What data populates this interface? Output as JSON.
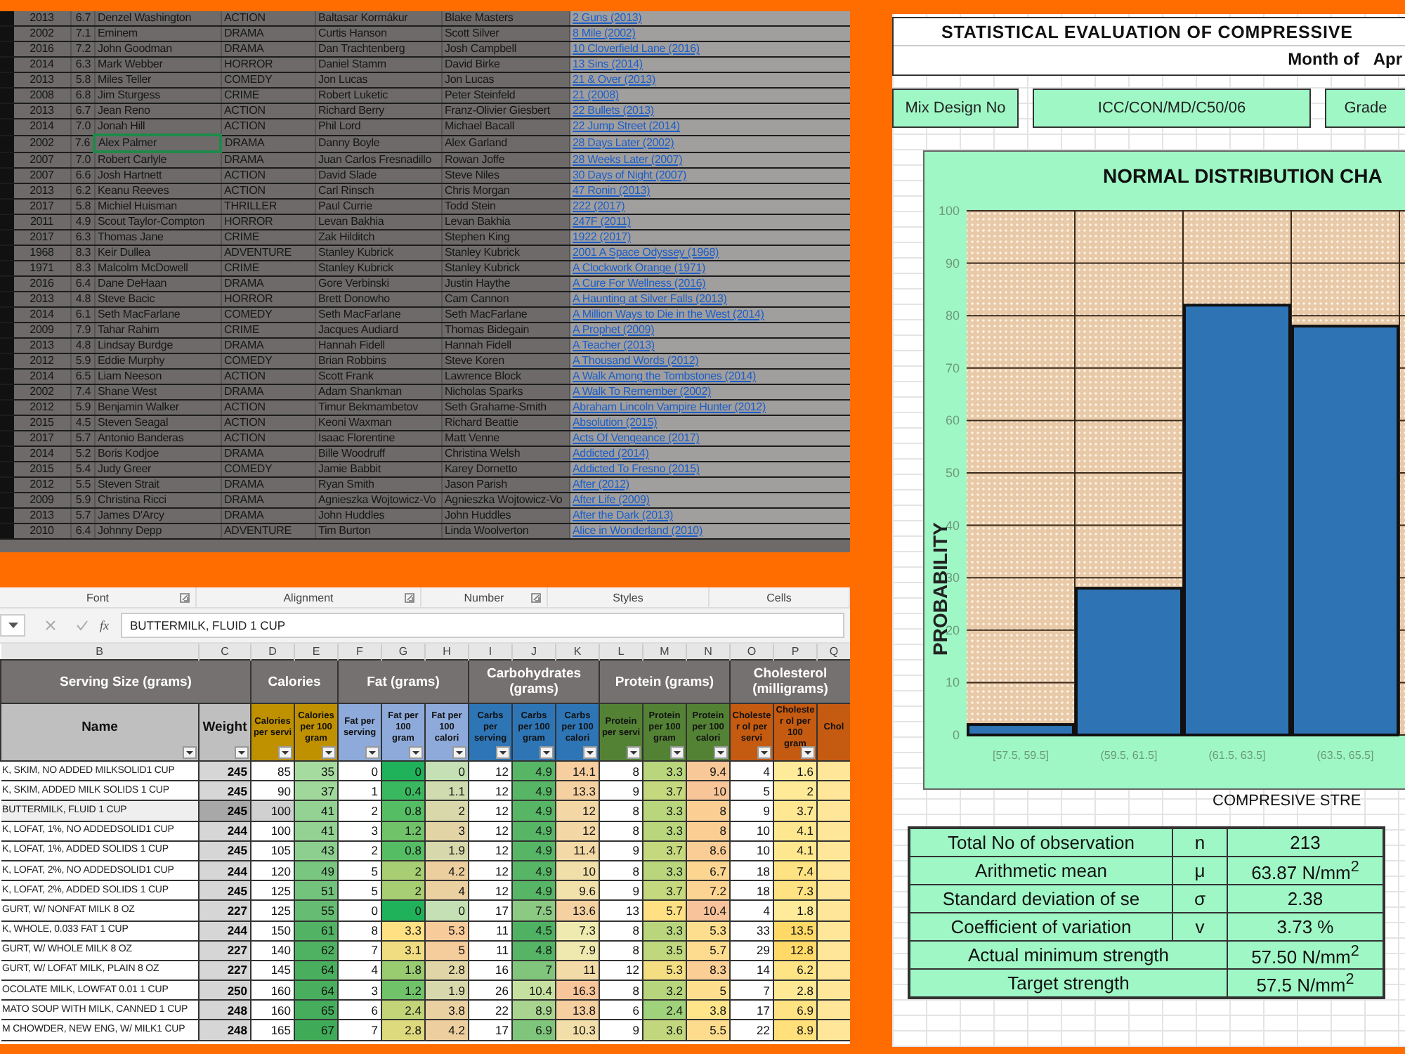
{
  "movies": {
    "rows": [
      {
        "year": "2013",
        "rating": "6.7",
        "actor": "Denzel Washington",
        "genre": "ACTION",
        "director": "Baltasar Kormákur",
        "writer": "Blake Masters",
        "title": "2 Guns (2013)",
        "selected": false
      },
      {
        "year": "2002",
        "rating": "7.1",
        "actor": "Eminem",
        "genre": "DRAMA",
        "director": "Curtis Hanson",
        "writer": "Scott Silver",
        "title": "8 Mile (2002)",
        "selected": false
      },
      {
        "year": "2016",
        "rating": "7.2",
        "actor": "John Goodman",
        "genre": "DRAMA",
        "director": "Dan Trachtenberg",
        "writer": "Josh Campbell",
        "title": "10 Cloverfield Lane (2016)",
        "selected": false
      },
      {
        "year": "2014",
        "rating": "6.3",
        "actor": "Mark Webber",
        "genre": "HORROR",
        "director": "Daniel Stamm",
        "writer": "David Birke",
        "title": "13 Sins (2014)",
        "selected": false
      },
      {
        "year": "2013",
        "rating": "5.8",
        "actor": "Miles Teller",
        "genre": "COMEDY",
        "director": "Jon Lucas",
        "writer": "Jon Lucas",
        "title": "21 & Over (2013)",
        "selected": false
      },
      {
        "year": "2008",
        "rating": "6.8",
        "actor": "Jim Sturgess",
        "genre": "CRIME",
        "director": "Robert Luketic",
        "writer": "Peter Steinfeld",
        "title": "21 (2008)",
        "selected": false
      },
      {
        "year": "2013",
        "rating": "6.7",
        "actor": "Jean Reno",
        "genre": "ACTION",
        "director": "Richard Berry",
        "writer": "Franz-Olivier Giesbert",
        "title": "22 Bullets (2013)",
        "selected": false
      },
      {
        "year": "2014",
        "rating": "7.0",
        "actor": "Jonah Hill",
        "genre": "ACTION",
        "director": "Phil Lord",
        "writer": "Michael Bacall",
        "title": "22 Jump Street (2014)",
        "selected": false
      },
      {
        "year": "2002",
        "rating": "7.6",
        "actor": "Alex Palmer",
        "genre": "DRAMA",
        "director": "Danny Boyle",
        "writer": "Alex Garland",
        "title": "28 Days Later (2002)",
        "selected": true
      },
      {
        "year": "2007",
        "rating": "7.0",
        "actor": "Robert Carlyle",
        "genre": "DRAMA",
        "director": "Juan Carlos Fresnadillo",
        "writer": "Rowan Joffe",
        "title": "28 Weeks Later (2007)",
        "selected": false
      },
      {
        "year": "2007",
        "rating": "6.6",
        "actor": "Josh Hartnett",
        "genre": "ACTION",
        "director": "David Slade",
        "writer": "Steve Niles",
        "title": "30 Days of Night (2007)",
        "selected": false
      },
      {
        "year": "2013",
        "rating": "6.2",
        "actor": "Keanu Reeves",
        "genre": "ACTION",
        "director": "Carl Rinsch",
        "writer": "Chris Morgan",
        "title": "47 Ronin (2013)",
        "selected": false
      },
      {
        "year": "2017",
        "rating": "5.8",
        "actor": "Michiel Huisman",
        "genre": "THRILLER",
        "director": "Paul Currie",
        "writer": "Todd Stein",
        "title": "222 (2017)",
        "selected": false
      },
      {
        "year": "2011",
        "rating": "4.9",
        "actor": "Scout Taylor-Compton",
        "genre": "HORROR",
        "director": "Levan Bakhia",
        "writer": "Levan Bakhia",
        "title": "247F (2011)",
        "selected": false
      },
      {
        "year": "2017",
        "rating": "6.3",
        "actor": "Thomas Jane",
        "genre": "CRIME",
        "director": "Zak Hilditch",
        "writer": "Stephen King",
        "title": "1922 (2017)",
        "selected": false
      },
      {
        "year": "1968",
        "rating": "8.3",
        "actor": "Keir Dullea",
        "genre": "ADVENTURE",
        "director": "Stanley Kubrick",
        "writer": "Stanley Kubrick",
        "title": "2001 A Space Odyssey (1968)",
        "selected": false
      },
      {
        "year": "1971",
        "rating": "8.3",
        "actor": "Malcolm McDowell",
        "genre": "CRIME",
        "director": "Stanley Kubrick",
        "writer": "Stanley Kubrick",
        "title": "A Clockwork Orange (1971)",
        "selected": false
      },
      {
        "year": "2016",
        "rating": "6.4",
        "actor": "Dane DeHaan",
        "genre": "DRAMA",
        "director": "Gore Verbinski",
        "writer": "Justin Haythe",
        "title": "A Cure For Wellness (2016)",
        "selected": false
      },
      {
        "year": "2013",
        "rating": "4.8",
        "actor": "Steve Bacic",
        "genre": "HORROR",
        "director": "Brett Donowho",
        "writer": "Cam Cannon",
        "title": "A Haunting at Silver Falls (2013)",
        "selected": false
      },
      {
        "year": "2014",
        "rating": "6.1",
        "actor": "Seth MacFarlane",
        "genre": "COMEDY",
        "director": "Seth MacFarlane",
        "writer": "Seth MacFarlane",
        "title": "A Million Ways to Die in the West (2014)",
        "selected": false
      },
      {
        "year": "2009",
        "rating": "7.9",
        "actor": "Tahar Rahim",
        "genre": "CRIME",
        "director": "Jacques Audiard",
        "writer": "Thomas Bidegain",
        "title": "A Prophet (2009)",
        "selected": false
      },
      {
        "year": "2013",
        "rating": "4.8",
        "actor": "Lindsay Burdge",
        "genre": "DRAMA",
        "director": "Hannah Fidell",
        "writer": "Hannah Fidell",
        "title": "A Teacher (2013)",
        "selected": false
      },
      {
        "year": "2012",
        "rating": "5.9",
        "actor": "Eddie Murphy",
        "genre": "COMEDY",
        "director": "Brian Robbins",
        "writer": "Steve Koren",
        "title": "A Thousand Words (2012)",
        "selected": false
      },
      {
        "year": "2014",
        "rating": "6.5",
        "actor": "Liam Neeson",
        "genre": "ACTION",
        "director": "Scott Frank",
        "writer": "Lawrence Block",
        "title": "A Walk Among the Tombstones (2014)",
        "selected": false
      },
      {
        "year": "2002",
        "rating": "7.4",
        "actor": "Shane West",
        "genre": "DRAMA",
        "director": "Adam Shankman",
        "writer": "Nicholas Sparks",
        "title": "A Walk To Remember (2002)",
        "selected": false
      },
      {
        "year": "2012",
        "rating": "5.9",
        "actor": "Benjamin Walker",
        "genre": "ACTION",
        "director": "Timur Bekmambetov",
        "writer": "Seth Grahame-Smith",
        "title": "Abraham Lincoln Vampire Hunter (2012)",
        "selected": false
      },
      {
        "year": "2015",
        "rating": "4.5",
        "actor": "Steven Seagal",
        "genre": "ACTION",
        "director": "Keoni Waxman",
        "writer": "Richard Beattie",
        "title": "Absolution (2015)",
        "selected": false
      },
      {
        "year": "2017",
        "rating": "5.7",
        "actor": "Antonio Banderas",
        "genre": "ACTION",
        "director": "Isaac Florentine",
        "writer": "Matt Venne",
        "title": "Acts Of Vengeance (2017)",
        "selected": false
      },
      {
        "year": "2014",
        "rating": "5.2",
        "actor": "Boris Kodjoe",
        "genre": "DRAMA",
        "director": "Bille Woodruff",
        "writer": "Christina Welsh",
        "title": "Addicted (2014)",
        "selected": false
      },
      {
        "year": "2015",
        "rating": "5.4",
        "actor": "Judy Greer",
        "genre": "COMEDY",
        "director": "Jamie Babbit",
        "writer": "Karey Dornetto",
        "title": "Addicted To Fresno (2015)",
        "selected": false
      },
      {
        "year": "2012",
        "rating": "5.5",
        "actor": "Steven Strait",
        "genre": "DRAMA",
        "director": "Ryan Smith",
        "writer": "Jason Parish",
        "title": "After (2012)",
        "selected": false
      },
      {
        "year": "2009",
        "rating": "5.9",
        "actor": "Christina Ricci",
        "genre": "DRAMA",
        "director": "Agnieszka Wojtowicz-Vo",
        "writer": "Agnieszka Wojtowicz-Vo",
        "title": "After Life (2009)",
        "selected": false
      },
      {
        "year": "2013",
        "rating": "5.7",
        "actor": "James D'Arcy",
        "genre": "DRAMA",
        "director": "John Huddles",
        "writer": "John Huddles",
        "title": "After the Dark (2013)",
        "selected": false
      },
      {
        "year": "2010",
        "rating": "6.4",
        "actor": "Johnny Depp",
        "genre": "ADVENTURE",
        "director": "Tim Burton",
        "writer": "Linda Woolverton",
        "title": "Alice in Wonderland (2010)",
        "selected": false
      }
    ]
  },
  "nutrition": {
    "ribbon_groups": [
      {
        "label": "Font",
        "launcher": true
      },
      {
        "label": "Alignment",
        "launcher": true
      },
      {
        "label": "Number",
        "launcher": true
      },
      {
        "label": "Styles",
        "launcher": false
      },
      {
        "label": "Cells",
        "launcher": false
      }
    ],
    "formula_bar": {
      "fx": "fx",
      "value": "BUTTERMILK, FLUID 1 CUP"
    },
    "column_letters": [
      "B",
      "C",
      "D",
      "E",
      "F",
      "G",
      "H",
      "I",
      "J",
      "K",
      "L",
      "M",
      "N",
      "O",
      "P",
      "Q"
    ],
    "groups": [
      {
        "label": "Serving Size (grams)",
        "color": "#bfbfbf",
        "columns": [
          "Name",
          "Weight"
        ]
      },
      {
        "label": "Calories",
        "color": "#bf9000",
        "columns": [
          "Calories per servi",
          "Calories per 100 gram"
        ]
      },
      {
        "label": "Fat (grams)",
        "color": "#8eaadb",
        "columns": [
          "Fat per serving",
          "Fat per 100 gram",
          "Fat per 100 calori"
        ]
      },
      {
        "label": "Carbohydrates (grams)",
        "color": "#2e75b6",
        "columns": [
          "Carbs per serving",
          "Carbs per 100 gram",
          "Carbs per 100 calori"
        ]
      },
      {
        "label": "Protein (grams)",
        "color": "#548235",
        "columns": [
          "Protein per servi",
          "Protein per 100 gram",
          "Protein per 100 calori"
        ]
      },
      {
        "label": "Cholesterol (milligrams)",
        "color": "#c55a11",
        "columns": [
          "Cholester ol per servi",
          "Cholester ol per 100 gram",
          "Chol"
        ]
      }
    ],
    "rows": [
      {
        "name": "K, SKIM, NO ADDED MILKSOLID1 CUP",
        "weight": "245",
        "values": [
          "85",
          "35",
          "0",
          "0",
          "0",
          "12",
          "4.9",
          "14.1",
          "8",
          "3.3",
          "9.4",
          "4",
          "1.6"
        ],
        "selected": false
      },
      {
        "name": "K, SKIM, ADDED MILK SOLIDS 1 CUP",
        "weight": "245",
        "values": [
          "90",
          "37",
          "1",
          "0.4",
          "1.1",
          "12",
          "4.9",
          "13.3",
          "9",
          "3.7",
          "10",
          "5",
          "2"
        ],
        "selected": false
      },
      {
        "name": "BUTTERMILK, FLUID 1 CUP",
        "weight": "245",
        "values": [
          "100",
          "41",
          "2",
          "0.8",
          "2",
          "12",
          "4.9",
          "12",
          "8",
          "3.3",
          "8",
          "9",
          "3.7"
        ],
        "selected": true
      },
      {
        "name": "K, LOFAT, 1%, NO ADDEDSOLID1 CUP",
        "weight": "244",
        "values": [
          "100",
          "41",
          "3",
          "1.2",
          "3",
          "12",
          "4.9",
          "12",
          "8",
          "3.3",
          "8",
          "10",
          "4.1"
        ],
        "selected": false
      },
      {
        "name": "K, LOFAT, 1%, ADDED SOLIDS 1 CUP",
        "weight": "245",
        "values": [
          "105",
          "43",
          "2",
          "0.8",
          "1.9",
          "12",
          "4.9",
          "11.4",
          "9",
          "3.7",
          "8.6",
          "10",
          "4.1"
        ],
        "selected": false
      },
      {
        "name": "K, LOFAT, 2%, NO ADDEDSOLID1 CUP",
        "weight": "244",
        "values": [
          "120",
          "49",
          "5",
          "2",
          "4.2",
          "12",
          "4.9",
          "10",
          "8",
          "3.3",
          "6.7",
          "18",
          "7.4"
        ],
        "selected": false
      },
      {
        "name": "K, LOFAT, 2%, ADDED SOLIDS 1 CUP",
        "weight": "245",
        "values": [
          "125",
          "51",
          "5",
          "2",
          "4",
          "12",
          "4.9",
          "9.6",
          "9",
          "3.7",
          "7.2",
          "18",
          "7.3"
        ],
        "selected": false
      },
      {
        "name": "GURT, W/ NONFAT MILK 8 OZ",
        "weight": "227",
        "values": [
          "125",
          "55",
          "0",
          "0",
          "0",
          "17",
          "7.5",
          "13.6",
          "13",
          "5.7",
          "10.4",
          "4",
          "1.8"
        ],
        "selected": false
      },
      {
        "name": "K, WHOLE, 0.033 FAT 1 CUP",
        "weight": "244",
        "values": [
          "150",
          "61",
          "8",
          "3.3",
          "5.3",
          "11",
          "4.5",
          "7.3",
          "8",
          "3.3",
          "5.3",
          "33",
          "13.5"
        ],
        "selected": false
      },
      {
        "name": "GURT, W/ WHOLE MILK 8 OZ",
        "weight": "227",
        "values": [
          "140",
          "62",
          "7",
          "3.1",
          "5",
          "11",
          "4.8",
          "7.9",
          "8",
          "3.5",
          "5.7",
          "29",
          "12.8"
        ],
        "selected": false
      },
      {
        "name": "GURT, W/ LOFAT MILK, PLAIN 8 OZ",
        "weight": "227",
        "values": [
          "145",
          "64",
          "4",
          "1.8",
          "2.8",
          "16",
          "7",
          "11",
          "12",
          "5.3",
          "8.3",
          "14",
          "6.2"
        ],
        "selected": false
      },
      {
        "name": "OCOLATE MILK, LOWFAT 0.01 1 CUP",
        "weight": "250",
        "values": [
          "160",
          "64",
          "3",
          "1.2",
          "1.9",
          "26",
          "10.4",
          "16.3",
          "8",
          "3.2",
          "5",
          "7",
          "2.8"
        ],
        "selected": false
      },
      {
        "name": "MATO SOUP WITH MILK, CANNED 1 CUP",
        "weight": "248",
        "values": [
          "160",
          "65",
          "6",
          "2.4",
          "3.8",
          "22",
          "8.9",
          "13.8",
          "6",
          "2.4",
          "3.8",
          "17",
          "6.9"
        ],
        "selected": false
      },
      {
        "name": "M CHOWDER, NEW ENG, W/ MILK1 CUP",
        "weight": "248",
        "values": [
          "165",
          "67",
          "7",
          "2.8",
          "4.2",
          "17",
          "6.9",
          "10.3",
          "9",
          "3.6",
          "5.5",
          "22",
          "8.9"
        ],
        "selected": false
      }
    ]
  },
  "evaluation": {
    "title": "STATISTICAL EVALUATION OF COMPRESSIVE",
    "month_label": "Month of",
    "month_value": "Apr",
    "mix_label": "Mix Design No",
    "mix_value": "ICC/CON/MD/C50/06",
    "grade_label": "Grade",
    "chart_title": "NORMAL DISTRIBUTION CHA",
    "chart_data": {
      "type": "bar",
      "ylabel": "PROBABILITY",
      "xlabel": "COMPRESIVE STRE",
      "categories": [
        "[57.5, 59.5]",
        "(59.5, 61.5]",
        "(61.5, 63.5]",
        "(63.5, 65.5]"
      ],
      "values": [
        2,
        28,
        82,
        78
      ],
      "grid": true,
      "ylim": [
        0,
        100
      ],
      "yticks": [
        0,
        10,
        20,
        30,
        40,
        50,
        60,
        70,
        80,
        90,
        100
      ]
    },
    "stats": [
      {
        "kind": "symbol",
        "label": "Total No of observation",
        "symbol": "n",
        "value": "213"
      },
      {
        "kind": "symbol",
        "label": "Arithmetic mean",
        "symbol": "μ",
        "value": "63.87 N/mm$^{2}$"
      },
      {
        "kind": "symbol",
        "label": "Standard deviation of se",
        "symbol": "σ",
        "value": "2.38"
      },
      {
        "kind": "symbol",
        "label": "Coefficient of variation",
        "symbol": "v",
        "value": "3.73 %"
      },
      {
        "kind": "wide",
        "label": "Actual minimum strength",
        "value": "57.50  N/mm$^{2}$"
      },
      {
        "kind": "wide",
        "label": "Target strength",
        "value": "57.5 N/mm$^{2}$"
      }
    ]
  }
}
